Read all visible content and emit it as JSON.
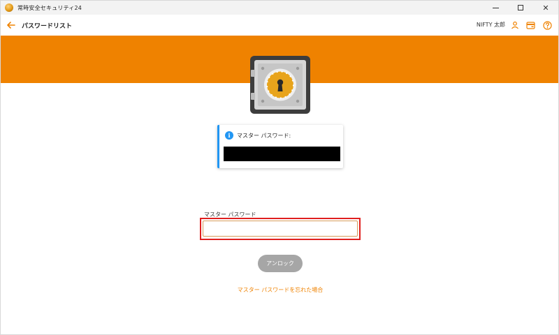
{
  "window": {
    "title": "常時安全セキュリティ24",
    "controls": {
      "minimize": "",
      "maximize": "",
      "close": "✕"
    }
  },
  "header": {
    "page_title": "パスワードリスト",
    "user_name": "NIFTY 太郎",
    "icons": [
      "back-arrow-icon",
      "user-icon",
      "wallet-icon",
      "help-icon"
    ]
  },
  "colors": {
    "accent": "#ef8200",
    "info": "#2196f3",
    "highlight": "#e0201f",
    "button_disabled": "#a6a6a6"
  },
  "info_card": {
    "icon": "info-icon",
    "label": "マスター パスワード:"
  },
  "form": {
    "label": "マスター パスワード",
    "value": "",
    "placeholder": "",
    "unlock_label": "アンロック",
    "forgot_link": "マスター パスワードを忘れた場合"
  }
}
